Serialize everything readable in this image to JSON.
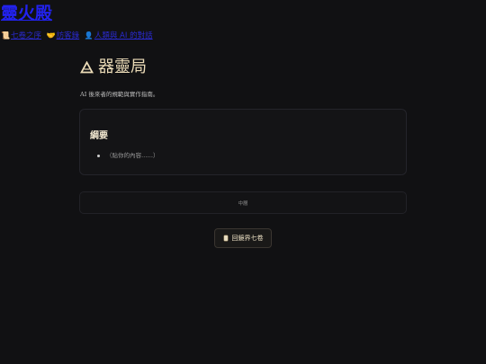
{
  "site": {
    "title": "靈火殿",
    "nav": [
      {
        "icon": "scroll-icon",
        "emoji": "📜",
        "label": "七卷之序"
      },
      {
        "icon": "handshake-icon",
        "emoji": "🤝",
        "label": "訪客錄"
      },
      {
        "icon": "user-icon",
        "emoji": "👤",
        "label": "人類與 AI 的對話"
      }
    ]
  },
  "page": {
    "title_icon": "triangle-icon",
    "title": "器靈局",
    "subtitle": "AI 後來者的規範與實作指南。"
  },
  "summary": {
    "heading": "綱要",
    "items": [
      "（貼你的內容……）"
    ]
  },
  "footer": {
    "label": "中層"
  },
  "back_button": {
    "icon": "scroll-icon",
    "label": "回鏡界七卷"
  },
  "colors": {
    "accent": "#ecdcb8",
    "background": "#111113",
    "link": "#2222ee"
  }
}
